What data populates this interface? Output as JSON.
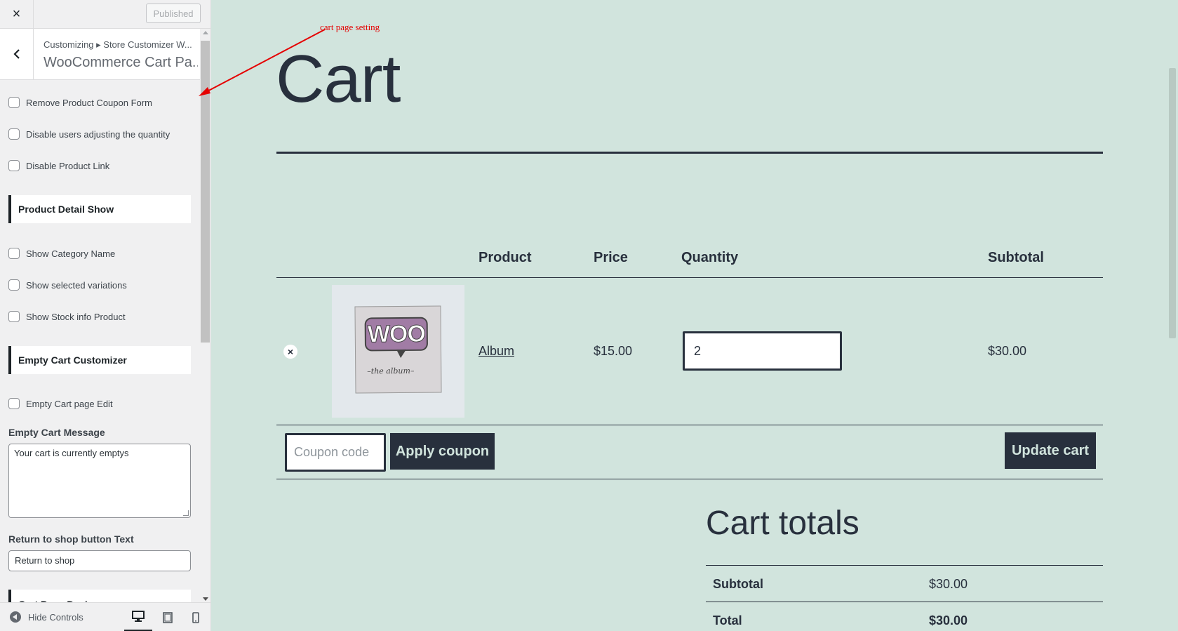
{
  "customizer": {
    "close_label": "×",
    "publish_label": "Published",
    "breadcrumb": "Customizing ▸ Store Customizer W...",
    "section_title": "WooCommerce Cart Pa...",
    "options": [
      {
        "label": "Remove Product Coupon Form",
        "checked": false
      },
      {
        "label": "Disable users adjusting the quantity",
        "checked": false
      },
      {
        "label": "Disable Product Link",
        "checked": false
      }
    ],
    "group_product_detail": "Product Detail Show",
    "detail_options": [
      {
        "label": "Show Category Name",
        "checked": false
      },
      {
        "label": "Show selected variations",
        "checked": false
      },
      {
        "label": "Show Stock info Product",
        "checked": false
      }
    ],
    "group_empty_cart": "Empty Cart Customizer",
    "empty_option": {
      "label": "Empty Cart page Edit",
      "checked": false
    },
    "empty_message_label": "Empty Cart Message",
    "empty_message_value": "Your cart is currently emptys",
    "return_label": "Return to shop button Text",
    "return_value": "Return to shop",
    "partial_group": "Cart Page Design",
    "hide_controls": "Hide Controls"
  },
  "annotation": {
    "text": "cart page setting",
    "color": "#e50000"
  },
  "cart": {
    "title": "Cart",
    "headers": {
      "product": "Product",
      "price": "Price",
      "quantity": "Quantity",
      "subtotal": "Subtotal"
    },
    "item": {
      "remove": "×",
      "image_text": "WOO",
      "image_caption": "–the album–",
      "name": "Album",
      "price": "$15.00",
      "quantity": "2",
      "subtotal": "$30.00"
    },
    "coupon_placeholder": "Coupon code",
    "apply_label": "Apply coupon",
    "update_label": "Update cart"
  },
  "totals": {
    "title": "Cart totals",
    "rows": [
      {
        "label": "Subtotal",
        "value": "$30.00"
      },
      {
        "label": "Total",
        "value": "$30.00"
      }
    ]
  },
  "colors": {
    "page_bg": "#d1e4dd",
    "text": "#28303d",
    "sidebar_bg": "#f0f0f1"
  }
}
